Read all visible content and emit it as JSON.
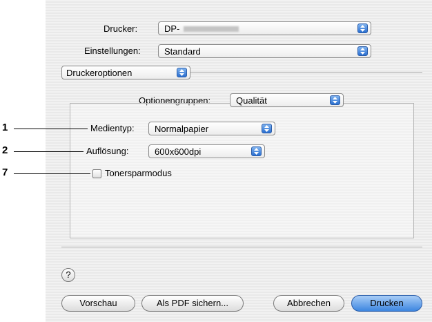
{
  "printer": {
    "label": "Drucker:",
    "value": "DP-"
  },
  "settings": {
    "label": "Einstellungen:",
    "value": "Standard"
  },
  "panel_select": {
    "value": "Druckeroptionen"
  },
  "option_groups": {
    "label": "Optionengruppen:",
    "value": "Qualität"
  },
  "media_type": {
    "label": "Medientyp:",
    "value": "Normalpapier"
  },
  "resolution": {
    "label": "Auflösung:",
    "value": "600x600dpi"
  },
  "toner_save": {
    "label": "Tonersparmodus",
    "checked": false
  },
  "callouts": [
    "1",
    "2",
    "7"
  ],
  "help": {
    "symbol": "?"
  },
  "buttons": {
    "preview": "Vorschau",
    "save_pdf": "Als PDF sichern...",
    "cancel": "Abbrechen",
    "print": "Drucken"
  }
}
